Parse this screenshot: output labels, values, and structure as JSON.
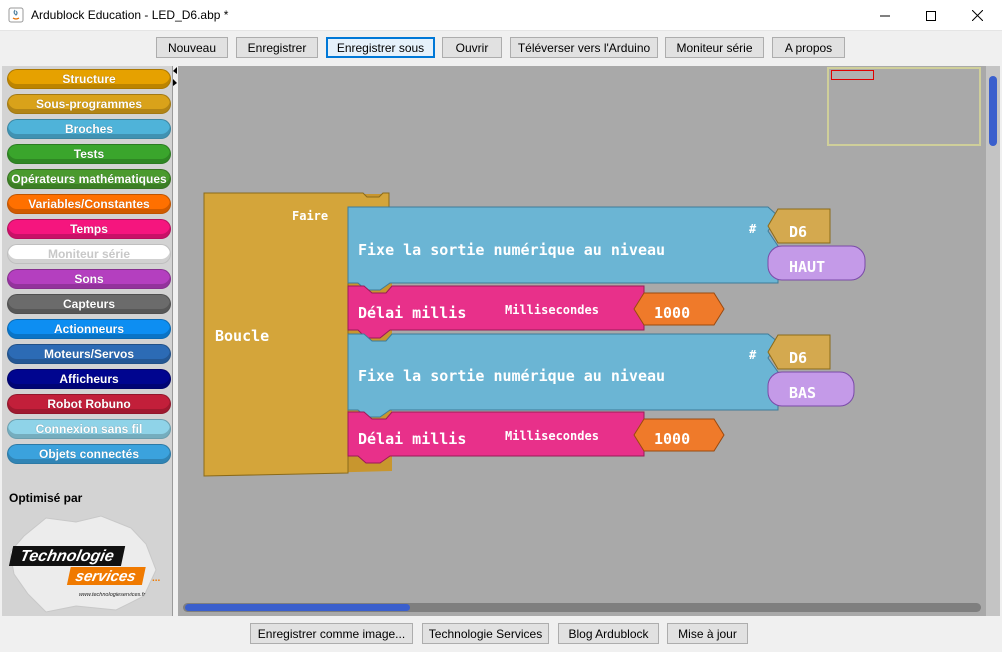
{
  "window": {
    "title": "Ardublock Education - LED_D6.abp *"
  },
  "toolbar": {
    "buttons": [
      {
        "label": "Nouveau"
      },
      {
        "label": "Enregistrer"
      },
      {
        "label": "Enregistrer sous",
        "active": true
      },
      {
        "label": "Ouvrir"
      },
      {
        "label": "Téléverser vers l'Arduino"
      },
      {
        "label": "Moniteur série"
      },
      {
        "label": "A propos"
      }
    ]
  },
  "palette": {
    "categories": [
      {
        "label": "Structure",
        "color": "#e6a100"
      },
      {
        "label": "Sous-programmes",
        "color": "#d9a21a"
      },
      {
        "label": "Broches",
        "color": "#4fb3d9"
      },
      {
        "label": "Tests",
        "color": "#3aa52c"
      },
      {
        "label": "Opérateurs mathématiques",
        "color": "#4a9a2e"
      },
      {
        "label": "Variables/Constantes",
        "color": "#ff7000"
      },
      {
        "label": "Temps",
        "color": "#f5157e"
      },
      {
        "label": "Moniteur série",
        "color": "#ffffff"
      },
      {
        "label": "Sons",
        "color": "#b43fbf"
      },
      {
        "label": "Capteurs",
        "color": "#6b6b6b"
      },
      {
        "label": "Actionneurs",
        "color": "#0d8ef2"
      },
      {
        "label": "Moteurs/Servos",
        "color": "#2c6bb5"
      },
      {
        "label": "Afficheurs",
        "color": "#00058f"
      },
      {
        "label": "Robot Robuno",
        "color": "#c21f3a"
      },
      {
        "label": "Connexion sans fil",
        "color": "#8fd3e8"
      },
      {
        "label": "Objets connectés",
        "color": "#3ba2dd"
      }
    ],
    "optimized_by": "Optimisé par",
    "logo": {
      "line1": "Technologie",
      "line2": "services",
      "url": "www.technologieservices.fr"
    }
  },
  "program": {
    "loop": {
      "label": "Boucle",
      "do_label": "Faire",
      "color": "#d4a53a"
    },
    "statements": [
      {
        "type": "digital_write",
        "label": "Fixe la sortie numérique au niveau",
        "pin_prefix": "#",
        "pin": "D6",
        "level": "HAUT"
      },
      {
        "type": "delay",
        "label": "Délai millis",
        "param_label": "Millisecondes",
        "value": "1000"
      },
      {
        "type": "digital_write",
        "label": "Fixe la sortie numérique au niveau",
        "pin_prefix": "#",
        "pin": "D6",
        "level": "BAS"
      },
      {
        "type": "delay",
        "label": "Délai millis",
        "param_label": "Millisecondes",
        "value": "1000"
      }
    ],
    "colors": {
      "digital_write": "#6bb5d4",
      "delay": "#e8308a",
      "number": "#ef7a2a",
      "pin": "#d4a94f",
      "level": "#c49ae8"
    }
  },
  "bottom": {
    "buttons": [
      {
        "label": "Enregistrer comme image..."
      },
      {
        "label": "Technologie Services"
      },
      {
        "label": "Blog Ardublock"
      },
      {
        "label": "Mise à jour"
      }
    ]
  }
}
